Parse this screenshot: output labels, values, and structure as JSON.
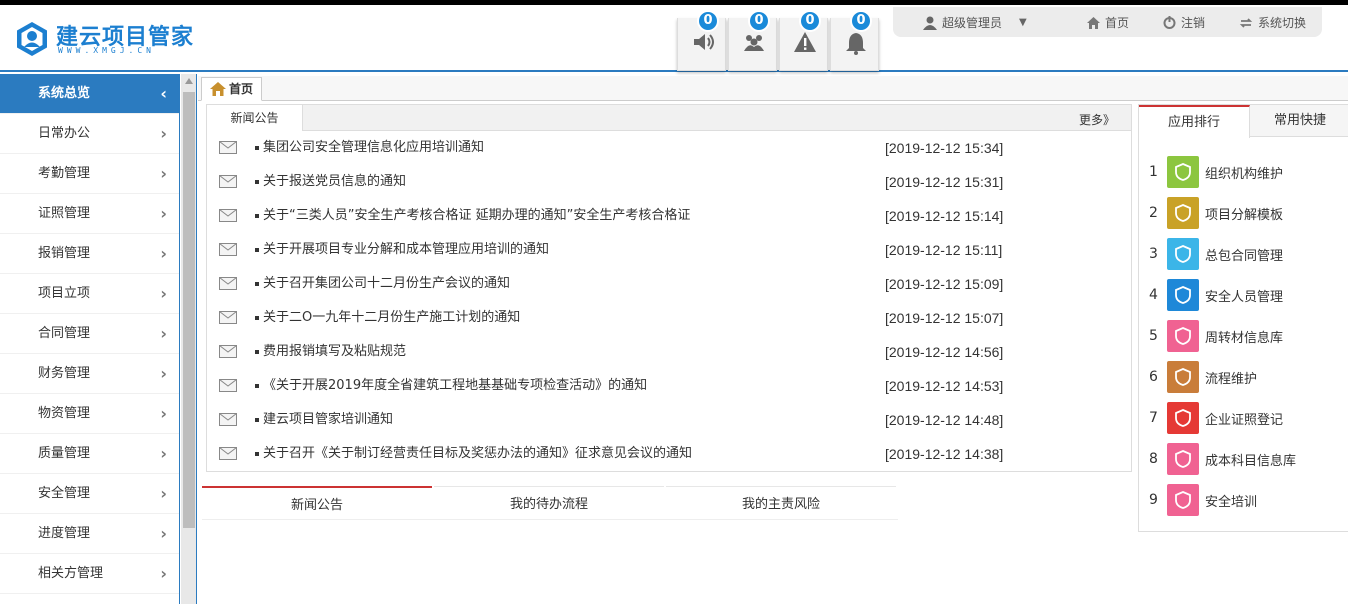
{
  "app": {
    "title": "建云项目管家",
    "subtitle": "WWW.XMGJ.CN"
  },
  "notifications": [
    {
      "icon": "speaker-icon",
      "count": "0"
    },
    {
      "icon": "people-icon",
      "count": "0"
    },
    {
      "icon": "warning-icon",
      "count": "0"
    },
    {
      "icon": "bell-icon",
      "count": "0"
    }
  ],
  "userbar": {
    "user": "超级管理员",
    "home": "首页",
    "logout": "注销",
    "switch": "系统切换"
  },
  "sidebar": {
    "items": [
      {
        "label": "系统总览",
        "active": true
      },
      {
        "label": "日常办公"
      },
      {
        "label": "考勤管理"
      },
      {
        "label": "证照管理"
      },
      {
        "label": "报销管理"
      },
      {
        "label": "项目立项"
      },
      {
        "label": "合同管理"
      },
      {
        "label": "财务管理"
      },
      {
        "label": "物资管理"
      },
      {
        "label": "质量管理"
      },
      {
        "label": "安全管理"
      },
      {
        "label": "进度管理"
      },
      {
        "label": "相关方管理"
      }
    ]
  },
  "tabs": {
    "home": "首页"
  },
  "news": {
    "tab": "新闻公告",
    "more": "更多》",
    "items": [
      {
        "title": "集团公司安全管理信息化应用培训通知",
        "date": "[2019-12-12 15:34]"
      },
      {
        "title": "关于报送党员信息的通知",
        "date": "[2019-12-12 15:31]"
      },
      {
        "title": "关于“三类人员”安全生产考核合格证 延期办理的通知”安全生产考核合格证",
        "date": "[2019-12-12 15:14]"
      },
      {
        "title": "关于开展项目专业分解和成本管理应用培训的通知",
        "date": "[2019-12-12 15:11]"
      },
      {
        "title": "关于召开集团公司十二月份生产会议的通知",
        "date": "[2019-12-12 15:09]"
      },
      {
        "title": "关于二O一九年十二月份生产施工计划的通知",
        "date": "[2019-12-12 15:07]"
      },
      {
        "title": "费用报销填写及粘贴规范",
        "date": "[2019-12-12 14:56]"
      },
      {
        "title": "《关于开展2019年度全省建筑工程地基基础专项检查活动》的通知",
        "date": "[2019-12-12 14:53]"
      },
      {
        "title": "建云项目管家培训通知",
        "date": "[2019-12-12 14:48]"
      },
      {
        "title": "关于召开《关于制订经营责任目标及奖惩办法的通知》征求意见会议的通知",
        "date": "[2019-12-12 14:38]"
      }
    ]
  },
  "bottom_tabs": [
    "新闻公告",
    "我的待办流程",
    "我的主责风险"
  ],
  "right_panel": {
    "tabs": [
      "应用排行",
      "常用快捷"
    ],
    "items": [
      {
        "n": "1",
        "label": "组织机构维护",
        "color": "#8cc63f"
      },
      {
        "n": "2",
        "label": "项目分解模板",
        "color": "#c9a227"
      },
      {
        "n": "3",
        "label": "总包合同管理",
        "color": "#3bb5e8"
      },
      {
        "n": "4",
        "label": "安全人员管理",
        "color": "#1e88d8"
      },
      {
        "n": "5",
        "label": "周转材信息库",
        "color": "#f06292"
      },
      {
        "n": "6",
        "label": "流程维护",
        "color": "#c97d3a"
      },
      {
        "n": "7",
        "label": "企业证照登记",
        "color": "#e53935"
      },
      {
        "n": "8",
        "label": "成本科目信息库",
        "color": "#f06292"
      },
      {
        "n": "9",
        "label": "安全培训",
        "color": "#f06292"
      }
    ]
  }
}
